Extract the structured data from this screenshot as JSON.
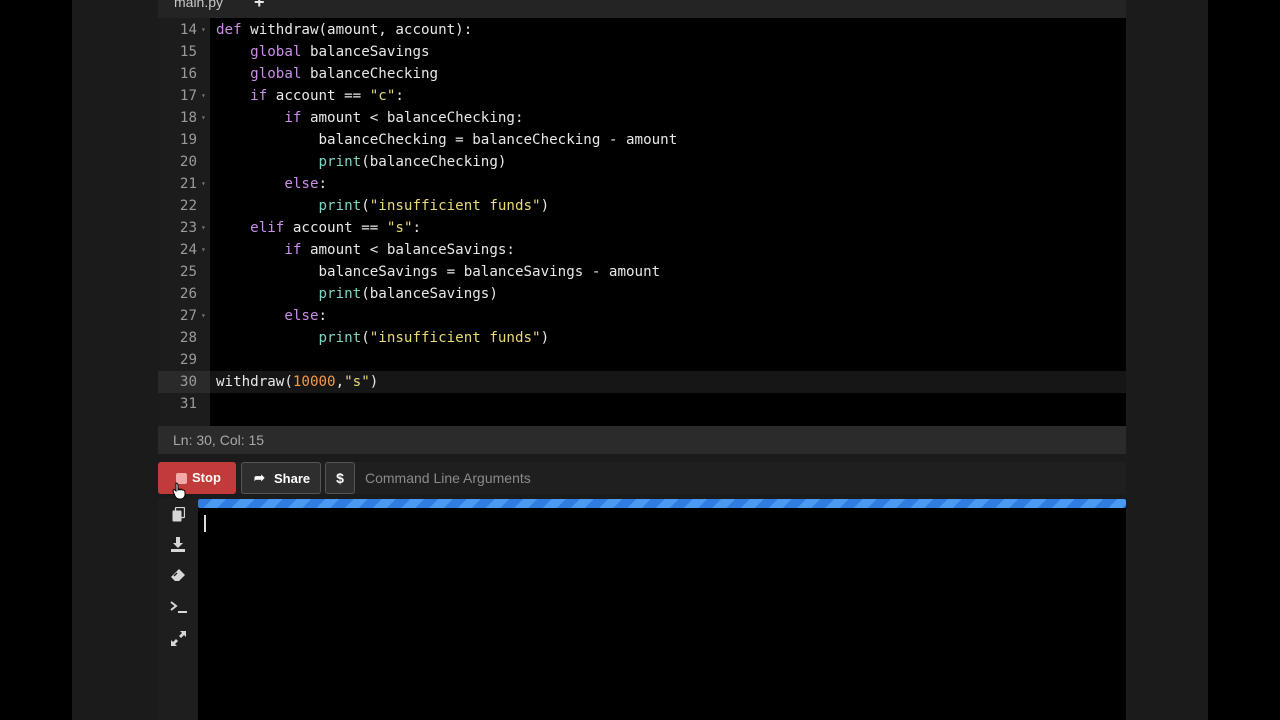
{
  "tab": {
    "name": "main.py",
    "add": "+"
  },
  "editor": {
    "lines": [
      {
        "num": "14",
        "fold": true,
        "tokens": [
          [
            "kw",
            "def "
          ],
          [
            "",
            "withdraw(amount, account):"
          ]
        ]
      },
      {
        "num": "15",
        "fold": false,
        "tokens": [
          [
            "",
            "    "
          ],
          [
            "kw",
            "global "
          ],
          [
            "",
            "balanceSavings"
          ]
        ]
      },
      {
        "num": "16",
        "fold": false,
        "tokens": [
          [
            "",
            "    "
          ],
          [
            "kw",
            "global "
          ],
          [
            "",
            "balanceChecking"
          ]
        ]
      },
      {
        "num": "17",
        "fold": true,
        "tokens": [
          [
            "",
            "    "
          ],
          [
            "kw",
            "if "
          ],
          [
            "",
            "account == "
          ],
          [
            "str",
            "\"c\""
          ],
          [
            "",
            ":"
          ]
        ]
      },
      {
        "num": "18",
        "fold": true,
        "tokens": [
          [
            "",
            "        "
          ],
          [
            "kw",
            "if "
          ],
          [
            "",
            "amount < balanceChecking:"
          ]
        ]
      },
      {
        "num": "19",
        "fold": false,
        "tokens": [
          [
            "",
            "            balanceChecking = balanceChecking - amount"
          ]
        ]
      },
      {
        "num": "20",
        "fold": false,
        "tokens": [
          [
            "",
            "            "
          ],
          [
            "bi",
            "print"
          ],
          [
            "",
            "(balanceChecking)"
          ]
        ]
      },
      {
        "num": "21",
        "fold": true,
        "tokens": [
          [
            "",
            "        "
          ],
          [
            "kw",
            "else"
          ],
          [
            "",
            ":"
          ]
        ]
      },
      {
        "num": "22",
        "fold": false,
        "tokens": [
          [
            "",
            "            "
          ],
          [
            "bi",
            "print"
          ],
          [
            "",
            "("
          ],
          [
            "str",
            "\"insufficient funds\""
          ],
          [
            "",
            ")"
          ]
        ]
      },
      {
        "num": "23",
        "fold": true,
        "tokens": [
          [
            "",
            "    "
          ],
          [
            "kw",
            "elif "
          ],
          [
            "",
            "account == "
          ],
          [
            "str",
            "\"s\""
          ],
          [
            "",
            ":"
          ]
        ]
      },
      {
        "num": "24",
        "fold": true,
        "tokens": [
          [
            "",
            "        "
          ],
          [
            "kw",
            "if "
          ],
          [
            "",
            "amount < balanceSavings:"
          ]
        ]
      },
      {
        "num": "25",
        "fold": false,
        "tokens": [
          [
            "",
            "            balanceSavings = balanceSavings - amount"
          ]
        ]
      },
      {
        "num": "26",
        "fold": false,
        "tokens": [
          [
            "",
            "            "
          ],
          [
            "bi",
            "print"
          ],
          [
            "",
            "(balanceSavings)"
          ]
        ]
      },
      {
        "num": "27",
        "fold": true,
        "tokens": [
          [
            "",
            "        "
          ],
          [
            "kw",
            "else"
          ],
          [
            "",
            ":"
          ]
        ]
      },
      {
        "num": "28",
        "fold": false,
        "tokens": [
          [
            "",
            "            "
          ],
          [
            "bi",
            "print"
          ],
          [
            "",
            "("
          ],
          [
            "str",
            "\"insufficient funds\""
          ],
          [
            "",
            ")"
          ]
        ]
      },
      {
        "num": "29",
        "fold": false,
        "tokens": []
      },
      {
        "num": "30",
        "fold": false,
        "active": true,
        "tokens": [
          [
            "",
            "withdraw("
          ],
          [
            "num",
            "10000"
          ],
          [
            "",
            ","
          ],
          [
            "str",
            "\"s\""
          ],
          [
            "",
            ")"
          ]
        ]
      },
      {
        "num": "31",
        "fold": false,
        "tokens": []
      }
    ]
  },
  "status": {
    "position": "Ln: 30, Col: 15"
  },
  "toolbar": {
    "stop_label": "Stop",
    "share_label": "Share",
    "dollar_label": "$",
    "cli_placeholder": "Command Line Arguments"
  },
  "console": {
    "tools": [
      "copy-icon",
      "download-icon",
      "eraser-icon",
      "terminal-icon",
      "expand-icon"
    ],
    "output": ""
  },
  "icons": {
    "share": "share-icon",
    "stop": "stop-square-icon"
  },
  "colors": {
    "stop": "#c23b3b",
    "progress": "#2f7de0",
    "keyword": "#c98ee8",
    "builtin": "#7fd4c4",
    "string": "#e6db74",
    "number": "#f39a4c"
  }
}
